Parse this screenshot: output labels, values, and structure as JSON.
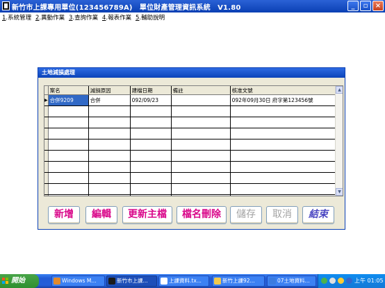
{
  "window": {
    "title": "新竹市上課專用單位(123456789A)　單位財產管理資訊系統　V1.80",
    "controls": [
      "_",
      "▫",
      "×"
    ]
  },
  "menu": [
    {
      "key": "1",
      "label": "系統管理"
    },
    {
      "key": "2",
      "label": "異動作業"
    },
    {
      "key": "3",
      "label": "查詢作業"
    },
    {
      "key": "4",
      "label": "報表作業"
    },
    {
      "key": "5",
      "label": "輔助說明"
    }
  ],
  "dialog": {
    "title": "土地減損處理",
    "columns": [
      "案名",
      "減損原因",
      "建檔日期",
      "備註",
      "核准文號"
    ],
    "rows": [
      {
        "indicator": "▶",
        "cells": [
          "合併9209",
          "合併",
          "092/09/23",
          "",
          "092年09月30日 府字第123456號"
        ]
      }
    ],
    "empty_rows": 9,
    "buttons": {
      "add": "新增",
      "edit": "編輯",
      "update_master": "更新主檔",
      "delete_record": "檔名刪除",
      "save": "儲存",
      "cancel": "取消",
      "exit": "結束"
    }
  },
  "taskbar": {
    "start_label": "開始",
    "tasks": [
      {
        "label": "Windows M...",
        "icon_color": "#e28a2c",
        "active": false
      },
      {
        "label": "新竹市上課...",
        "icon_color": "#1c1c1c",
        "active": true
      },
      {
        "label": "上課資料.tx...",
        "icon_color": "#ffffff",
        "active": false
      },
      {
        "label": "新竹上課92...",
        "icon_color": "#f2c94c",
        "active": false
      },
      {
        "label": "07土地資料...",
        "icon_color": "#3a7be0",
        "active": false
      }
    ],
    "clock": "上午 01:05"
  }
}
